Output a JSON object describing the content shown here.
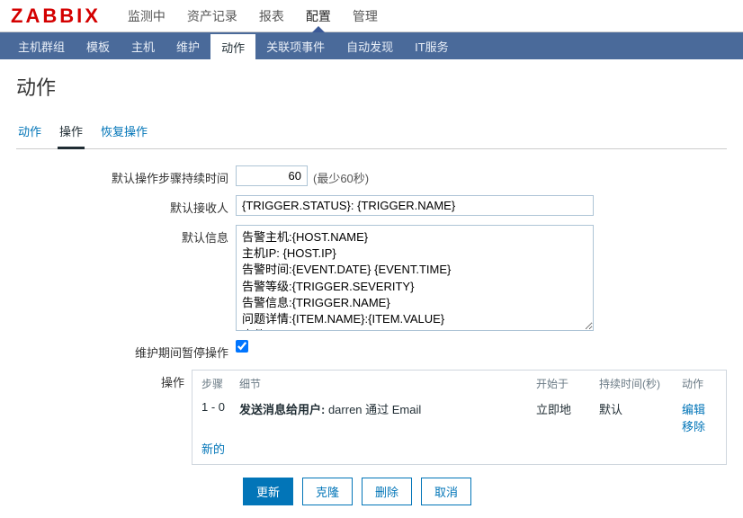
{
  "logo": "ZABBIX",
  "topnav": [
    {
      "label": "监测中",
      "active": false
    },
    {
      "label": "资产记录",
      "active": false
    },
    {
      "label": "报表",
      "active": false
    },
    {
      "label": "配置",
      "active": true
    },
    {
      "label": "管理",
      "active": false
    }
  ],
  "subnav": [
    {
      "label": "主机群组",
      "active": false
    },
    {
      "label": "模板",
      "active": false
    },
    {
      "label": "主机",
      "active": false
    },
    {
      "label": "维护",
      "active": false
    },
    {
      "label": "动作",
      "active": true
    },
    {
      "label": "关联项事件",
      "active": false
    },
    {
      "label": "自动发现",
      "active": false
    },
    {
      "label": "IT服务",
      "active": false
    }
  ],
  "page_title": "动作",
  "tabs": [
    {
      "label": "动作",
      "active": false
    },
    {
      "label": "操作",
      "active": true
    },
    {
      "label": "恢复操作",
      "active": false
    }
  ],
  "form": {
    "duration_label": "默认操作步骤持续时间",
    "duration_value": "60",
    "duration_hint": "(最少60秒)",
    "recipient_label": "默认接收人",
    "recipient_value": "{TRIGGER.STATUS}: {TRIGGER.NAME}",
    "message_label": "默认信息",
    "message_value": "告警主机:{HOST.NAME}\n主机IP: {HOST.IP}\n告警时间:{EVENT.DATE} {EVENT.TIME}\n告警等级:{TRIGGER.SEVERITY}\n告警信息:{TRIGGER.NAME}\n问题详情:{ITEM.NAME}:{ITEM.VALUE}\n事件ID: {EVENT.ID}",
    "pause_label": "维护期间暂停操作",
    "pause_checked": true,
    "ops_label": "操作"
  },
  "ops": {
    "headers": {
      "step": "步骤",
      "detail": "细节",
      "start": "开始于",
      "duration": "持续时间(秒)",
      "action": "动作"
    },
    "rows": [
      {
        "step": "1 - 0",
        "detail_prefix": "发送消息给用户:",
        "detail_rest": " darren 通过 Email",
        "start": "立即地",
        "duration": "默认",
        "edit": "编辑",
        "remove": "移除"
      }
    ],
    "new": "新的"
  },
  "buttons": {
    "update": "更新",
    "clone": "克隆",
    "delete": "删除",
    "cancel": "取消"
  }
}
